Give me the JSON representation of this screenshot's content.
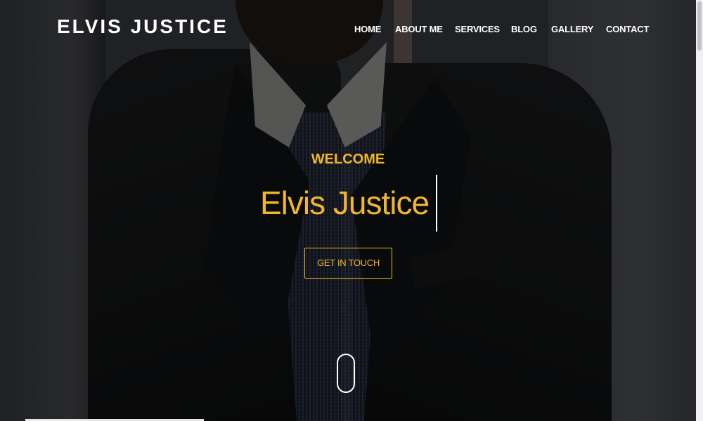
{
  "header": {
    "logo": "ELVIS JUSTICE",
    "nav": [
      {
        "label": "HOME"
      },
      {
        "label": "ABOUT ME"
      },
      {
        "label": "SERVICES"
      },
      {
        "label": "BLOG"
      },
      {
        "label": "GALLERY"
      },
      {
        "label": "CONTACT"
      }
    ]
  },
  "hero": {
    "welcome": "WELCOME",
    "headline": "Elvis Justice",
    "cta_label": "GET IN TOUCH",
    "scroll_icon": "mouse-scroll-icon"
  },
  "colors": {
    "accent": "#f0b62f",
    "text_light": "#ffffff",
    "overlay": "rgba(0,0,0,0.45)"
  }
}
